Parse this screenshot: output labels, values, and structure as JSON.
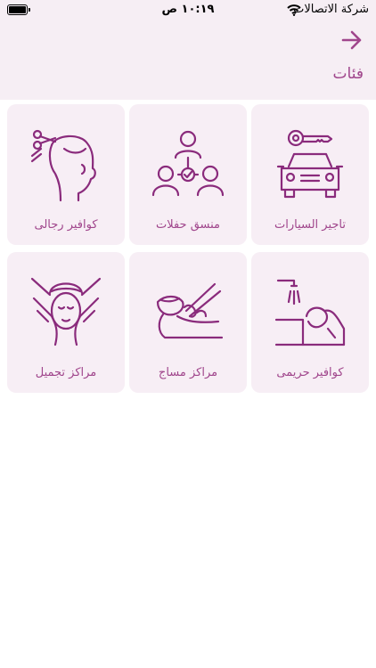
{
  "status_bar": {
    "carrier": "شركة الاتصالات",
    "time": "١٠:١٩ ص"
  },
  "header": {
    "title": "فئات",
    "back_icon": "arrow-right-icon"
  },
  "categories": [
    {
      "label": "تاجير السيارات",
      "icon": "car-key-icon"
    },
    {
      "label": "منسق حفلات",
      "icon": "people-network-icon"
    },
    {
      "label": "كوافير رجالى",
      "icon": "men-haircut-icon"
    },
    {
      "label": "كوافير حريمى",
      "icon": "hair-wash-icon"
    },
    {
      "label": "مراكز مساج",
      "icon": "massage-icon"
    },
    {
      "label": "مراكز تجميل",
      "icon": "facial-treatment-icon"
    }
  ],
  "colors": {
    "accent": "#a0468c",
    "icon_stroke": "#8a2b7c",
    "tile_bg": "#f7eef5",
    "header_bg": "#f6eef4"
  }
}
